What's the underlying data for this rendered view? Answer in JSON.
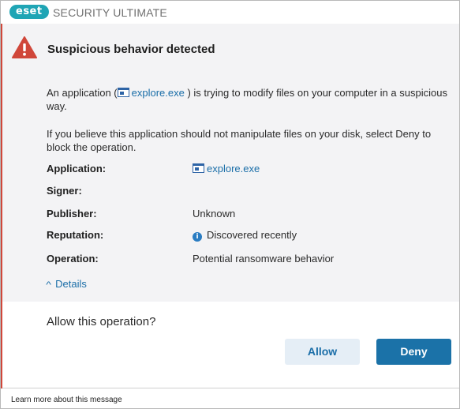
{
  "titlebar": {
    "logo_text": "eset",
    "product_name": "SECURITY ULTIMATE"
  },
  "alert": {
    "icon": "warning-triangle-icon",
    "heading": "Suspicious behavior detected",
    "description_prefix": "An application (",
    "description_app": "explore.exe",
    "description_suffix": ") is trying to modify files on your computer in a suspicious way.",
    "advice": "If you believe this application should not manipulate files on your disk, select Deny to block the operation."
  },
  "details": {
    "rows": [
      {
        "label": "Application:",
        "value": "explore.exe",
        "icon": "exe-file-icon"
      },
      {
        "label": "Signer:",
        "value": ""
      },
      {
        "label": "Publisher:",
        "value": "Unknown"
      },
      {
        "label": "Reputation:",
        "value": "Discovered recently",
        "icon": "info-icon"
      },
      {
        "label": "Operation:",
        "value": "Potential ransomware behavior"
      }
    ],
    "toggle_label": "Details",
    "toggle_icon": "chevron-up-icon"
  },
  "prompt": {
    "question": "Allow this operation?",
    "allow_label": "Allow",
    "deny_label": "Deny"
  },
  "footer": {
    "learn_more": "Learn more about this message"
  },
  "colors": {
    "accent": "#1b72a8",
    "warning": "#d0473a",
    "logo": "#1fa5b5",
    "panel_background": "#f3f3f5"
  }
}
